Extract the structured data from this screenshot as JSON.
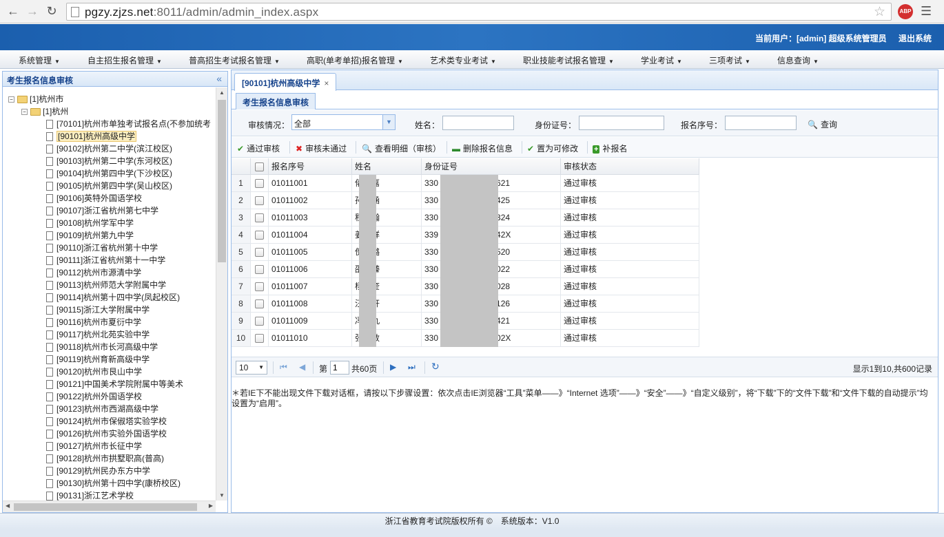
{
  "browser": {
    "url_host": "pgzy.zjzs.net",
    "url_rest": ":8011/admin/admin_index.aspx",
    "ext_label": "ABP"
  },
  "header": {
    "current_user": "当前用户：[admin] 超级系统管理员",
    "logout": "退出系统"
  },
  "topnav": [
    "系统管理",
    "自主招生报名管理",
    "普高招生考试报名管理",
    "高职(单考单招)报名管理",
    "艺术类专业考试",
    "职业技能考试报名管理",
    "学业考试",
    "三项考试",
    "信息查询"
  ],
  "left_panel": {
    "title": "考生报名信息审核",
    "tree_root": "[1]杭州市",
    "tree_child": "[1]杭州",
    "schools": [
      "[70101]杭州市单独考试报名点(不参加统考",
      "[90101]杭州高级中学",
      "[90102]杭州第二中学(滨江校区)",
      "[90103]杭州第二中学(东河校区)",
      "[90104]杭州第四中学(下沙校区)",
      "[90105]杭州第四中学(吴山校区)",
      "[90106]英特外国语学校",
      "[90107]浙江省杭州第七中学",
      "[90108]杭州学军中学",
      "[90109]杭州第九中学",
      "[90110]浙江省杭州第十中学",
      "[90111]浙江省杭州第十一中学",
      "[90112]杭州市源清中学",
      "[90113]杭州师范大学附属中学",
      "[90114]杭州第十四中学(凤起校区)",
      "[90115]浙江大学附属中学",
      "[90116]杭州市夏衍中学",
      "[90117]杭州北苑实验中学",
      "[90118]杭州市长河高级中学",
      "[90119]杭州育新高级中学",
      "[90120]杭州市艮山中学",
      "[90121]中国美术学院附属中等美术",
      "[90122]杭州外国语学校",
      "[90123]杭州市西湖高级中学",
      "[90124]杭州市保俶塔实验学校",
      "[90126]杭州市实验外国语学校",
      "[90127]杭州市长征中学",
      "[90128]杭州市拱墅职高(普高)",
      "[90129]杭州民办东方中学",
      "[90130]杭州第十四中学(康桥校区)",
      "[90131]浙江艺术学校"
    ],
    "selected_index": 1
  },
  "main": {
    "tab_label": "[90101]杭州高级中学",
    "tab_close": "×",
    "subtab_label": "考生报名信息审核",
    "filter": {
      "status_label": "审核情况：",
      "status_value": "全部",
      "name_label": "姓名：",
      "id_label": "身份证号：",
      "reg_label": "报名序号：",
      "search_label": "查询"
    },
    "toolbar": {
      "approve": "通过审核",
      "reject": "审核未通过",
      "view_detail": "查看明细（审核）",
      "delete": "删除报名信息",
      "set_editable": "置为可修改",
      "supplement": "补报名"
    },
    "columns": [
      "报名序号",
      "姓名",
      "身份证号",
      "审核状态"
    ],
    "rows": [
      {
        "n": "1",
        "reg": "01011001",
        "name_a": "俵",
        "name_b": "嘉",
        "id_a": "330",
        "id_b": "621",
        "status": "通过审核"
      },
      {
        "n": "2",
        "reg": "01011002",
        "name_a": "孙",
        "name_b": "涵",
        "id_a": "330",
        "id_b": "425",
        "status": "通过审核"
      },
      {
        "n": "3",
        "reg": "01011003",
        "name_a": "程",
        "name_b": "瀚",
        "id_a": "330",
        "id_b": "324",
        "status": "通过审核"
      },
      {
        "n": "4",
        "reg": "01011004",
        "name_a": "姜",
        "name_b": "祥",
        "id_a": "339",
        "id_b": "42X",
        "status": "通过审核"
      },
      {
        "n": "5",
        "reg": "01011005",
        "name_a": "倪",
        "name_b": "璐",
        "id_a": "330",
        "id_b": "520",
        "status": "通过审核"
      },
      {
        "n": "6",
        "reg": "01011006",
        "name_a": "邵",
        "name_b": "臻",
        "id_a": "330",
        "id_b": "022",
        "status": "通过审核"
      },
      {
        "n": "7",
        "reg": "01011007",
        "name_a": "杨",
        "name_b": "奎",
        "id_a": "330",
        "id_b": "028",
        "status": "通过审核"
      },
      {
        "n": "8",
        "reg": "01011008",
        "name_a": "汪",
        "name_b": "轩",
        "id_a": "330",
        "id_b": "126",
        "status": "通过审核"
      },
      {
        "n": "9",
        "reg": "01011009",
        "name_a": "冯",
        "name_b": "丸",
        "id_a": "330",
        "id_b": "421",
        "status": "通过审核"
      },
      {
        "n": "10",
        "reg": "01011010",
        "name_a": "张",
        "name_b": "敦",
        "id_a": "330",
        "id_b": "02X",
        "status": "通过审核"
      }
    ],
    "pager": {
      "page_size": "10",
      "page_prefix": "第",
      "page_value": "1",
      "page_total": "共60页",
      "info": "显示1到10,共600记录"
    },
    "note": "＊若IE下不能出现文件下载对话框，请按以下步骤设置：依次点击IE浏览器“工具”菜单——》“Internet 选项”——》“安全”——》“自定义级别”，将“下载”下的“文件下载”和“文件下载的自动提示”均设置为“启用”。"
  },
  "footer": "浙江省教育考试院版权所有 ©　系统版本：V1.0",
  "colors": {
    "header_blue": "#1b5fae",
    "panel_border": "#99bbe8",
    "panel_title": "#15428b"
  }
}
